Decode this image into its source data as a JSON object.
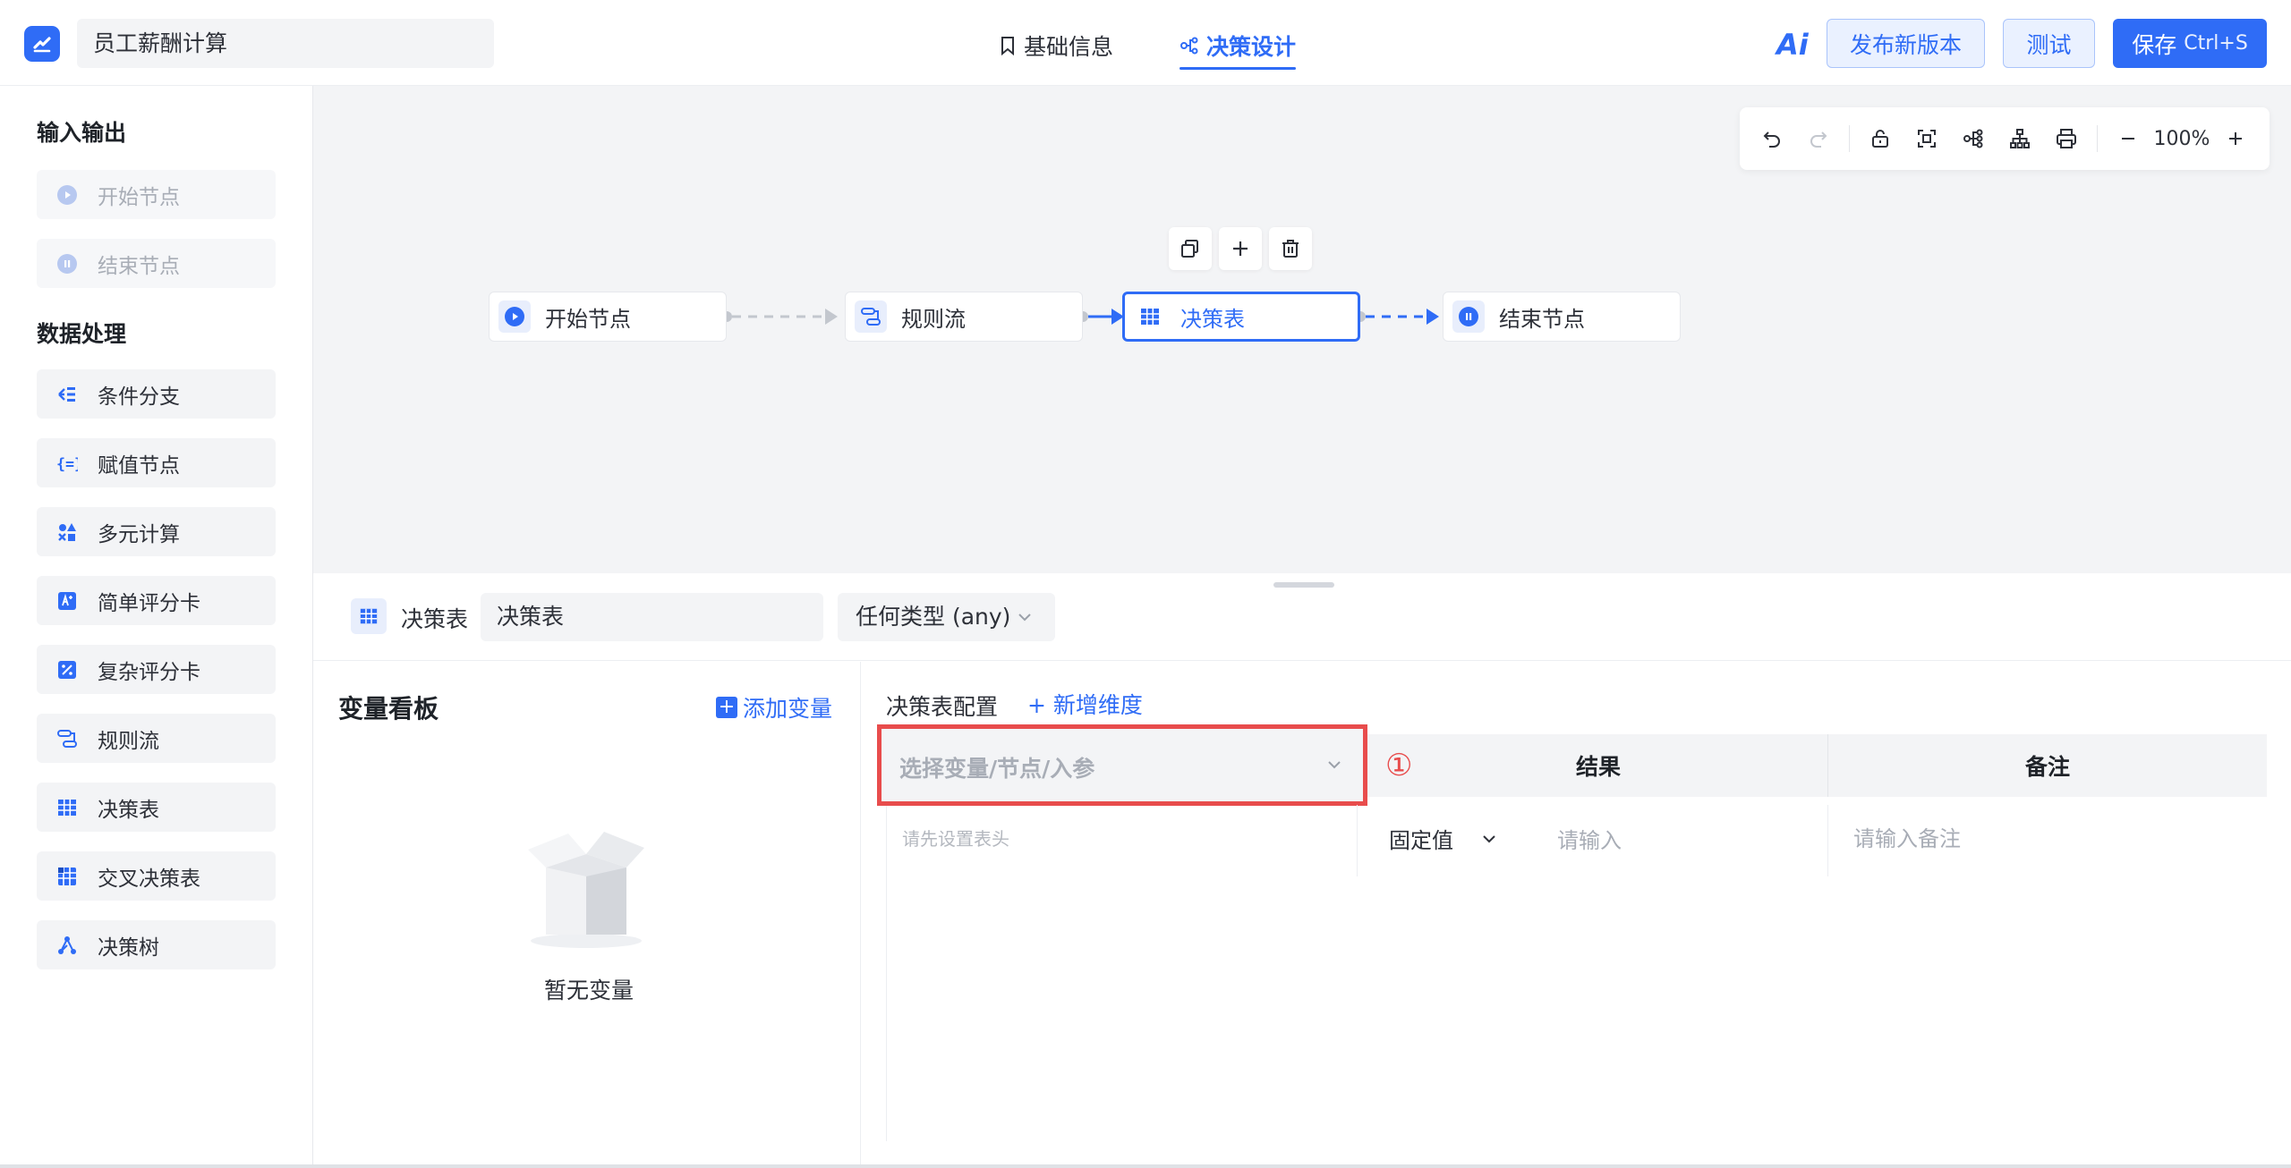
{
  "header": {
    "app_title": "员工薪酬计算",
    "tabs": [
      {
        "label": "基础信息",
        "icon": "bookmark-icon"
      },
      {
        "label": "决策设计",
        "icon": "flow-icon",
        "active": true
      }
    ],
    "ai_label": "Ai",
    "publish_label": "发布新版本",
    "test_label": "测试",
    "save_label": "保存",
    "save_shortcut": "Ctrl+S"
  },
  "sidebar": {
    "sections": [
      {
        "heading": "输入输出",
        "items": [
          {
            "label": "开始节点",
            "icon": "play-circle-icon",
            "disabled": true
          },
          {
            "label": "结束节点",
            "icon": "pause-circle-icon",
            "disabled": true
          }
        ]
      },
      {
        "heading": "数据处理",
        "items": [
          {
            "label": "条件分支",
            "icon": "branch-icon"
          },
          {
            "label": "赋值节点",
            "icon": "braces-icon"
          },
          {
            "label": "多元计算",
            "icon": "shapes-icon"
          },
          {
            "label": "简单评分卡",
            "icon": "score-card-icon"
          },
          {
            "label": "复杂评分卡",
            "icon": "percent-card-icon"
          },
          {
            "label": "规则流",
            "icon": "rule-flow-icon"
          },
          {
            "label": "决策表",
            "icon": "table-icon"
          },
          {
            "label": "交叉决策表",
            "icon": "cross-table-icon"
          },
          {
            "label": "决策树",
            "icon": "tree-icon"
          }
        ]
      }
    ]
  },
  "canvas": {
    "zoom": "100%",
    "nodes": [
      {
        "label": "开始节点",
        "icon": "play-circle-icon"
      },
      {
        "label": "规则流",
        "icon": "rule-flow-icon"
      },
      {
        "label": "决策表",
        "icon": "table-icon",
        "selected": true
      },
      {
        "label": "结束节点",
        "icon": "pause-circle-icon"
      }
    ]
  },
  "panel": {
    "node_type_label": "决策表",
    "node_name": "决策表",
    "return_type": "任何类型 (any)",
    "variable_board": {
      "title": "变量看板",
      "add_label": "添加变量",
      "empty_text": "暂无变量"
    },
    "decision_table": {
      "title": "决策表配置",
      "add_dimension_label": "+ 新增维度",
      "variable_placeholder": "选择变量/节点/入参",
      "marker": "①",
      "result_header": "结果",
      "note_header": "备注",
      "row_hint": "请先设置表头",
      "result_type": "固定值",
      "result_placeholder": "请输入",
      "note_placeholder": "请输入备注"
    }
  },
  "colors": {
    "accent": "#2f6cf6",
    "highlight": "#e84c4c"
  }
}
